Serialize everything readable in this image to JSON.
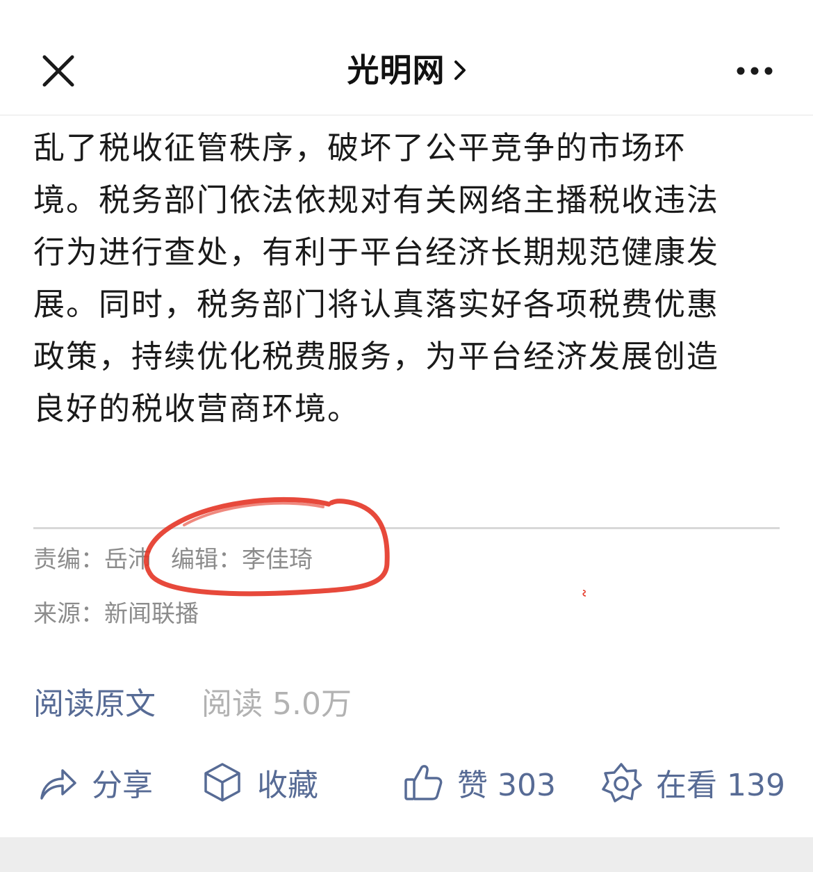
{
  "navbar": {
    "title": "光明网"
  },
  "article": {
    "lines": [
      "乱了税收征管秩序，破坏了公平竞争的市场环",
      "境。税务部门依法依规对有关网络主播税收违法",
      "行为进行查处，有利于平台经济长期规范健康发",
      "展。同时，税务部门将认真落实好各项税费优惠",
      "政策，持续优化税费服务，为平台经济发展创造",
      "良好的税收营商环境。"
    ]
  },
  "meta": {
    "editor_label": "责编：",
    "editor_name": "岳沛",
    "editor2_label": "编辑：",
    "editor2_name": "李佳琦",
    "source_label": "来源：",
    "source_name": "新闻联播"
  },
  "read": {
    "original_label": "阅读原文",
    "count_label": "阅读 5.0万"
  },
  "actions": {
    "share_label": "分享",
    "favorite_label": "收藏",
    "like_label": "赞 303",
    "viewing_label": "在看 139"
  },
  "colors": {
    "link": "#576b95",
    "meta_text": "#8c8c8c",
    "annotation": "#e53a2a"
  },
  "icons": [
    "close-icon",
    "chevron-right-icon",
    "more-icon",
    "share-icon",
    "cube-icon",
    "thumbs-up-icon",
    "flower-icon"
  ]
}
